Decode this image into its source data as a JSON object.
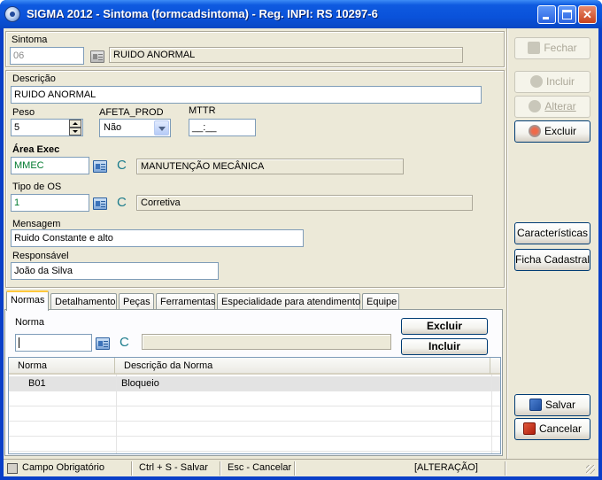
{
  "window": {
    "title": "SIGMA 2012 - Sintoma  (formcadsintoma)  - Reg. INPI: RS 10297-6"
  },
  "form": {
    "sintoma_label": "Sintoma",
    "sintoma_code": "06",
    "sintoma_name": "RUIDO ANORMAL",
    "descricao_label": "Descrição",
    "descricao_value": "RUIDO ANORMAL",
    "peso_label": "Peso",
    "peso_value": "5",
    "afeta_label": "AFETA_PROD",
    "afeta_value": "Não",
    "mttr_label": "MTTR",
    "mttr_value": "__:__",
    "area_label": "Área Exec",
    "area_code": "MMEC",
    "area_c": "C",
    "area_name": "MANUTENÇÃO MECÂNICA",
    "tipo_label": "Tipo de OS",
    "tipo_code": "1",
    "tipo_c": "C",
    "tipo_name": "Corretiva",
    "mensagem_label": "Mensagem",
    "mensagem_value": "Ruido Constante e alto",
    "responsavel_label": "Responsável",
    "responsavel_value": "João da Silva"
  },
  "right_buttons": {
    "fechar": "Fechar",
    "incluir": "Incluir",
    "alterar": "Alterar",
    "excluir": "Excluir",
    "caracteristicas": "Características",
    "ficha": "Ficha Cadastral",
    "salvar": "Salvar",
    "cancelar": "Cancelar"
  },
  "tabs": [
    {
      "label": "Normas"
    },
    {
      "label": "Detalhamento"
    },
    {
      "label": "Peças"
    },
    {
      "label": "Ferramentas"
    },
    {
      "label": "Especialidade para atendimento"
    },
    {
      "label": "Equipe"
    }
  ],
  "normas": {
    "norma_label": "Norma",
    "c_letter": "C",
    "excluir": "Excluir",
    "incluir": "Incluir",
    "grid": {
      "columns": [
        "Norma",
        "Descrição da Norma"
      ],
      "rows": [
        {
          "norma": "B01",
          "descricao": "Bloqueio"
        }
      ]
    }
  },
  "status": {
    "campo": "Campo Obrigatório",
    "salvar": "Ctrl + S - Salvar",
    "cancelar": "Esc - Cancelar",
    "mode": "[ALTERAÇÃO]"
  },
  "colors": {
    "titlebar": "#0a52da",
    "face": "#ece9d8",
    "green_text": "#007a2e",
    "c_letter": "#1c7c8c",
    "tab_highlight": "#ffc83c"
  }
}
